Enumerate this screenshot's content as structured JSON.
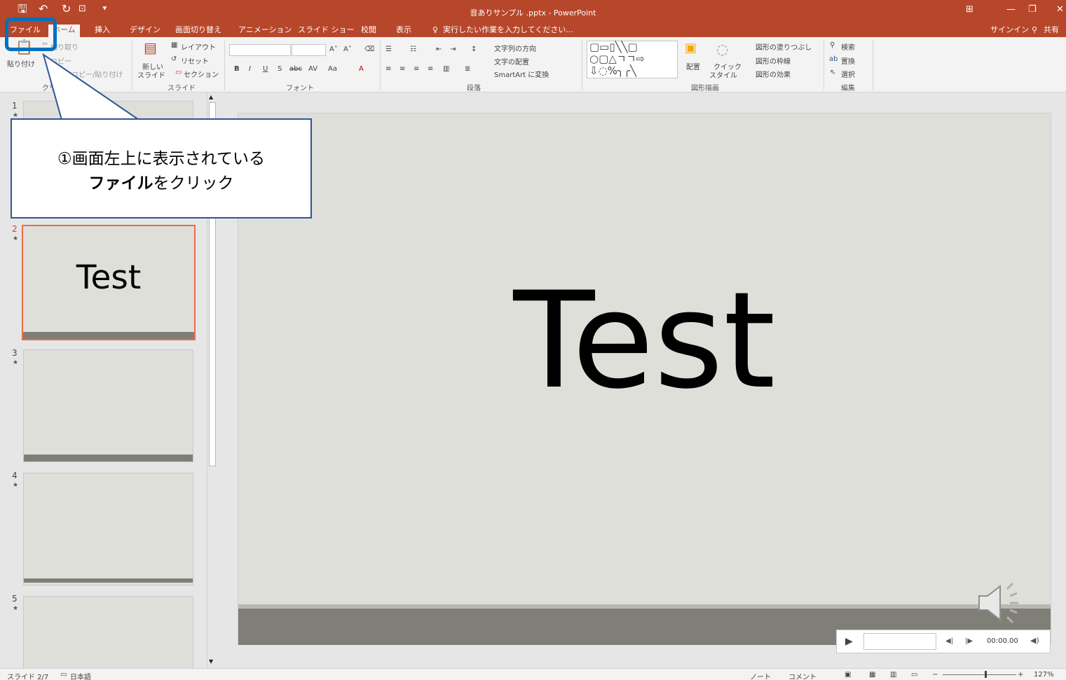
{
  "window": {
    "title": "音ありサンプル .pptx - PowerPoint",
    "signin": "サインイン",
    "share": "共有"
  },
  "ribbon_tabs": [
    "ファイル",
    "ホーム",
    "挿入",
    "デザイン",
    "画面切り替え",
    "アニメーション",
    "スライド ショー",
    "校閲",
    "表示"
  ],
  "tell_me": "実行したい作業を入力してください...",
  "ribbon": {
    "clipboard": {
      "paste": "貼り付け",
      "cut": "切り取り",
      "copy": "コピー",
      "format_painter": "書式のコピー/貼り付け",
      "group": "クリップボード"
    },
    "slides": {
      "new_slide_1": "新しい",
      "new_slide_2": "スライド",
      "layout": "レイアウト",
      "reset": "リセット",
      "section": "セクション",
      "group": "スライド"
    },
    "font": {
      "group": "フォント",
      "aa": "Aa"
    },
    "paragraph": {
      "text_direction": "文字列の方向",
      "align_text": "文字の配置",
      "smartart": "SmartArt に変換",
      "group": "段落"
    },
    "drawing": {
      "arrange": "配置",
      "quick_styles_1": "クイック",
      "quick_styles_2": "スタイル",
      "fill": "図形の塗りつぶし",
      "outline": "図形の枠線",
      "effects": "図形の効果",
      "group": "図形描画"
    },
    "editing": {
      "find": "検索",
      "replace": "置換",
      "select": "選択",
      "group": "編集"
    }
  },
  "slides": [
    {
      "num": "1",
      "text": ""
    },
    {
      "num": "2",
      "text": "Test"
    },
    {
      "num": "3",
      "text": ""
    },
    {
      "num": "4",
      "text": ""
    },
    {
      "num": "5",
      "text": ""
    }
  ],
  "main_slide": {
    "text": "Test"
  },
  "player": {
    "time": "00:00.00"
  },
  "status": {
    "slide_info": "スライド 2/7",
    "language": "日本語",
    "notes": "ノート",
    "comments": "コメント",
    "zoom": "127%"
  },
  "callout": {
    "line1": "①画面左上に表示されている",
    "line2_bold": "ファイル",
    "line2_rest": "をクリック"
  },
  "colors": {
    "accent": "#b7472a",
    "callout_border": "#2f5597",
    "highlight": "#0070c0"
  }
}
